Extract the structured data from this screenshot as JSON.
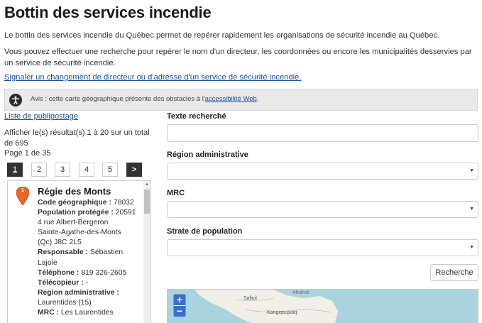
{
  "page": {
    "title": "Bottin des services incendie",
    "intro": "Le bottin des services incendie du Québec permet de repérer rapidement les organisations de sécurité incendie au Québec.",
    "intro2": "Vous pouvez effectuer une recherche pour repérer le nom d'un directeur, les coordonnées ou encore les municipalités desservies par un service de sécurité incendie.",
    "signal_link": "Signaler un changement de directeur ou d'adresse d'un service de sécurité incendie",
    "signal_dot": "."
  },
  "notice": {
    "text_before": "Avis : cette carte géographique présente des obstacles à l'",
    "link": "accessibilité Web",
    "text_after": "."
  },
  "results": {
    "mailing_link": "Liste de publipostage",
    "summary": "Afficher le(s) résultat(s) 1 à 20 sur un total de 695",
    "page_info": "Page 1 de 35",
    "pages": [
      "1",
      "2",
      "3",
      "4",
      "5"
    ],
    "next": ">",
    "active_page": "1"
  },
  "entry": {
    "marker": "1",
    "name": "Régie des Monts",
    "code_label": "Code géographique :",
    "code_value": "78032",
    "population_label": "Population protégée :",
    "population_value": "20591",
    "address_line1": "4 rue Albert-Bergeron",
    "address_line2": "Sainte-Agathe-des-Monts",
    "address_line3": "(Qc) J8C 2L5",
    "responsable_label": "Responsable :",
    "responsable_value": "Sébastien Lajoie",
    "telephone_label": "Téléphone :",
    "telephone_value": "819 326-2605",
    "telecopieur_label": "Télécopieur :",
    "telecopieur_value": "-",
    "region_label": "Region administrative :",
    "region_value": "Laurentides (15)",
    "mrc_label": "MRC :",
    "mrc_value": "Les Laurentides"
  },
  "form": {
    "search_label": "Texte recherché",
    "search_value": "",
    "region_label": "Région administrative",
    "region_value": "",
    "mrc_label": "MRC",
    "mrc_value": "",
    "strate_label": "Strate de population",
    "strate_value": "",
    "search_button": "Recherche"
  },
  "map": {
    "zoom_in": "+",
    "zoom_out": "−",
    "labels": [
      "Salluit",
      "Kangiqsujuaq",
      "Akulivik"
    ]
  },
  "colors": {
    "link": "#1a4f9c",
    "pin": "#e8662a",
    "water": "#aad3df",
    "zoom": "#3a6fc4",
    "active_page": "#333333"
  }
}
